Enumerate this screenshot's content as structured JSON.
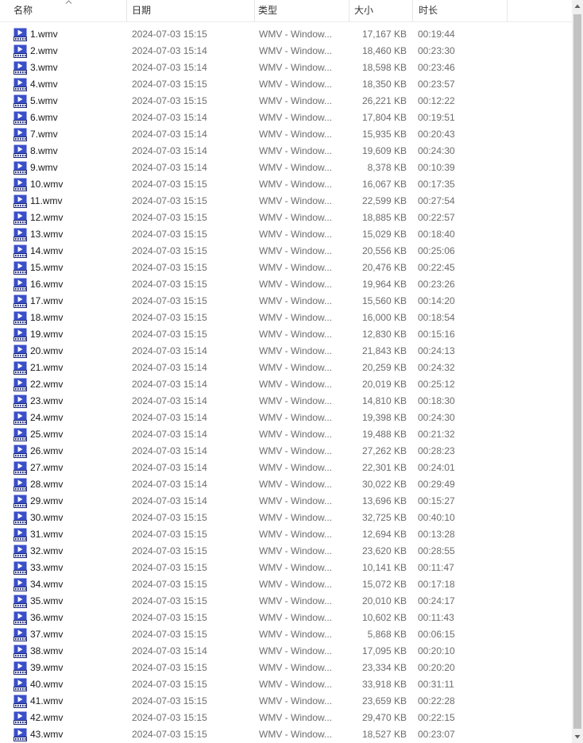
{
  "columns": {
    "name": "名称",
    "date": "日期",
    "type": "类型",
    "size": "大小",
    "duration": "时长"
  },
  "colors": {
    "icon_blue": "#3a4fc8",
    "scroll_thumb": "#c2c2c2"
  },
  "icons": {
    "file": "wmv-video-file-icon",
    "sort": "sort-ascending-icon"
  },
  "files": [
    {
      "name": "1.wmv",
      "date": "2024-07-03 15:15",
      "type": "WMV - Window...",
      "size": "17,167 KB",
      "duration": "00:19:44"
    },
    {
      "name": "2.wmv",
      "date": "2024-07-03 15:14",
      "type": "WMV - Window...",
      "size": "18,460 KB",
      "duration": "00:23:30"
    },
    {
      "name": "3.wmv",
      "date": "2024-07-03 15:14",
      "type": "WMV - Window...",
      "size": "18,598 KB",
      "duration": "00:23:46"
    },
    {
      "name": "4.wmv",
      "date": "2024-07-03 15:15",
      "type": "WMV - Window...",
      "size": "18,350 KB",
      "duration": "00:23:57"
    },
    {
      "name": "5.wmv",
      "date": "2024-07-03 15:15",
      "type": "WMV - Window...",
      "size": "26,221 KB",
      "duration": "00:12:22"
    },
    {
      "name": "6.wmv",
      "date": "2024-07-03 15:14",
      "type": "WMV - Window...",
      "size": "17,804 KB",
      "duration": "00:19:51"
    },
    {
      "name": "7.wmv",
      "date": "2024-07-03 15:14",
      "type": "WMV - Window...",
      "size": "15,935 KB",
      "duration": "00:20:43"
    },
    {
      "name": "8.wmv",
      "date": "2024-07-03 15:14",
      "type": "WMV - Window...",
      "size": "19,609 KB",
      "duration": "00:24:30"
    },
    {
      "name": "9.wmv",
      "date": "2024-07-03 15:14",
      "type": "WMV - Window...",
      "size": "8,378 KB",
      "duration": "00:10:39"
    },
    {
      "name": "10.wmv",
      "date": "2024-07-03 15:15",
      "type": "WMV - Window...",
      "size": "16,067 KB",
      "duration": "00:17:35"
    },
    {
      "name": "11.wmv",
      "date": "2024-07-03 15:15",
      "type": "WMV - Window...",
      "size": "22,599 KB",
      "duration": "00:27:54"
    },
    {
      "name": "12.wmv",
      "date": "2024-07-03 15:15",
      "type": "WMV - Window...",
      "size": "18,885 KB",
      "duration": "00:22:57"
    },
    {
      "name": "13.wmv",
      "date": "2024-07-03 15:15",
      "type": "WMV - Window...",
      "size": "15,029 KB",
      "duration": "00:18:40"
    },
    {
      "name": "14.wmv",
      "date": "2024-07-03 15:15",
      "type": "WMV - Window...",
      "size": "20,556 KB",
      "duration": "00:25:06"
    },
    {
      "name": "15.wmv",
      "date": "2024-07-03 15:15",
      "type": "WMV - Window...",
      "size": "20,476 KB",
      "duration": "00:22:45"
    },
    {
      "name": "16.wmv",
      "date": "2024-07-03 15:15",
      "type": "WMV - Window...",
      "size": "19,964 KB",
      "duration": "00:23:26"
    },
    {
      "name": "17.wmv",
      "date": "2024-07-03 15:15",
      "type": "WMV - Window...",
      "size": "15,560 KB",
      "duration": "00:14:20"
    },
    {
      "name": "18.wmv",
      "date": "2024-07-03 15:15",
      "type": "WMV - Window...",
      "size": "16,000 KB",
      "duration": "00:18:54"
    },
    {
      "name": "19.wmv",
      "date": "2024-07-03 15:15",
      "type": "WMV - Window...",
      "size": "12,830 KB",
      "duration": "00:15:16"
    },
    {
      "name": "20.wmv",
      "date": "2024-07-03 15:14",
      "type": "WMV - Window...",
      "size": "21,843 KB",
      "duration": "00:24:13"
    },
    {
      "name": "21.wmv",
      "date": "2024-07-03 15:14",
      "type": "WMV - Window...",
      "size": "20,259 KB",
      "duration": "00:24:32"
    },
    {
      "name": "22.wmv",
      "date": "2024-07-03 15:14",
      "type": "WMV - Window...",
      "size": "20,019 KB",
      "duration": "00:25:12"
    },
    {
      "name": "23.wmv",
      "date": "2024-07-03 15:14",
      "type": "WMV - Window...",
      "size": "14,810 KB",
      "duration": "00:18:30"
    },
    {
      "name": "24.wmv",
      "date": "2024-07-03 15:14",
      "type": "WMV - Window...",
      "size": "19,398 KB",
      "duration": "00:24:30"
    },
    {
      "name": "25.wmv",
      "date": "2024-07-03 15:14",
      "type": "WMV - Window...",
      "size": "19,488 KB",
      "duration": "00:21:32"
    },
    {
      "name": "26.wmv",
      "date": "2024-07-03 15:14",
      "type": "WMV - Window...",
      "size": "27,262 KB",
      "duration": "00:28:23"
    },
    {
      "name": "27.wmv",
      "date": "2024-07-03 15:14",
      "type": "WMV - Window...",
      "size": "22,301 KB",
      "duration": "00:24:01"
    },
    {
      "name": "28.wmv",
      "date": "2024-07-03 15:14",
      "type": "WMV - Window...",
      "size": "30,022 KB",
      "duration": "00:29:49"
    },
    {
      "name": "29.wmv",
      "date": "2024-07-03 15:14",
      "type": "WMV - Window...",
      "size": "13,696 KB",
      "duration": "00:15:27"
    },
    {
      "name": "30.wmv",
      "date": "2024-07-03 15:15",
      "type": "WMV - Window...",
      "size": "32,725 KB",
      "duration": "00:40:10"
    },
    {
      "name": "31.wmv",
      "date": "2024-07-03 15:15",
      "type": "WMV - Window...",
      "size": "12,694 KB",
      "duration": "00:13:28"
    },
    {
      "name": "32.wmv",
      "date": "2024-07-03 15:15",
      "type": "WMV - Window...",
      "size": "23,620 KB",
      "duration": "00:28:55"
    },
    {
      "name": "33.wmv",
      "date": "2024-07-03 15:15",
      "type": "WMV - Window...",
      "size": "10,141 KB",
      "duration": "00:11:47"
    },
    {
      "name": "34.wmv",
      "date": "2024-07-03 15:15",
      "type": "WMV - Window...",
      "size": "15,072 KB",
      "duration": "00:17:18"
    },
    {
      "name": "35.wmv",
      "date": "2024-07-03 15:15",
      "type": "WMV - Window...",
      "size": "20,010 KB",
      "duration": "00:24:17"
    },
    {
      "name": "36.wmv",
      "date": "2024-07-03 15:15",
      "type": "WMV - Window...",
      "size": "10,602 KB",
      "duration": "00:11:43"
    },
    {
      "name": "37.wmv",
      "date": "2024-07-03 15:15",
      "type": "WMV - Window...",
      "size": "5,868 KB",
      "duration": "00:06:15"
    },
    {
      "name": "38.wmv",
      "date": "2024-07-03 15:14",
      "type": "WMV - Window...",
      "size": "17,095 KB",
      "duration": "00:20:10"
    },
    {
      "name": "39.wmv",
      "date": "2024-07-03 15:15",
      "type": "WMV - Window...",
      "size": "23,334 KB",
      "duration": "00:20:20"
    },
    {
      "name": "40.wmv",
      "date": "2024-07-03 15:15",
      "type": "WMV - Window...",
      "size": "33,918 KB",
      "duration": "00:31:11"
    },
    {
      "name": "41.wmv",
      "date": "2024-07-03 15:15",
      "type": "WMV - Window...",
      "size": "23,659 KB",
      "duration": "00:22:28"
    },
    {
      "name": "42.wmv",
      "date": "2024-07-03 15:15",
      "type": "WMV - Window...",
      "size": "29,470 KB",
      "duration": "00:22:15"
    },
    {
      "name": "43.wmv",
      "date": "2024-07-03 15:15",
      "type": "WMV - Window...",
      "size": "18,527 KB",
      "duration": "00:23:07"
    }
  ]
}
